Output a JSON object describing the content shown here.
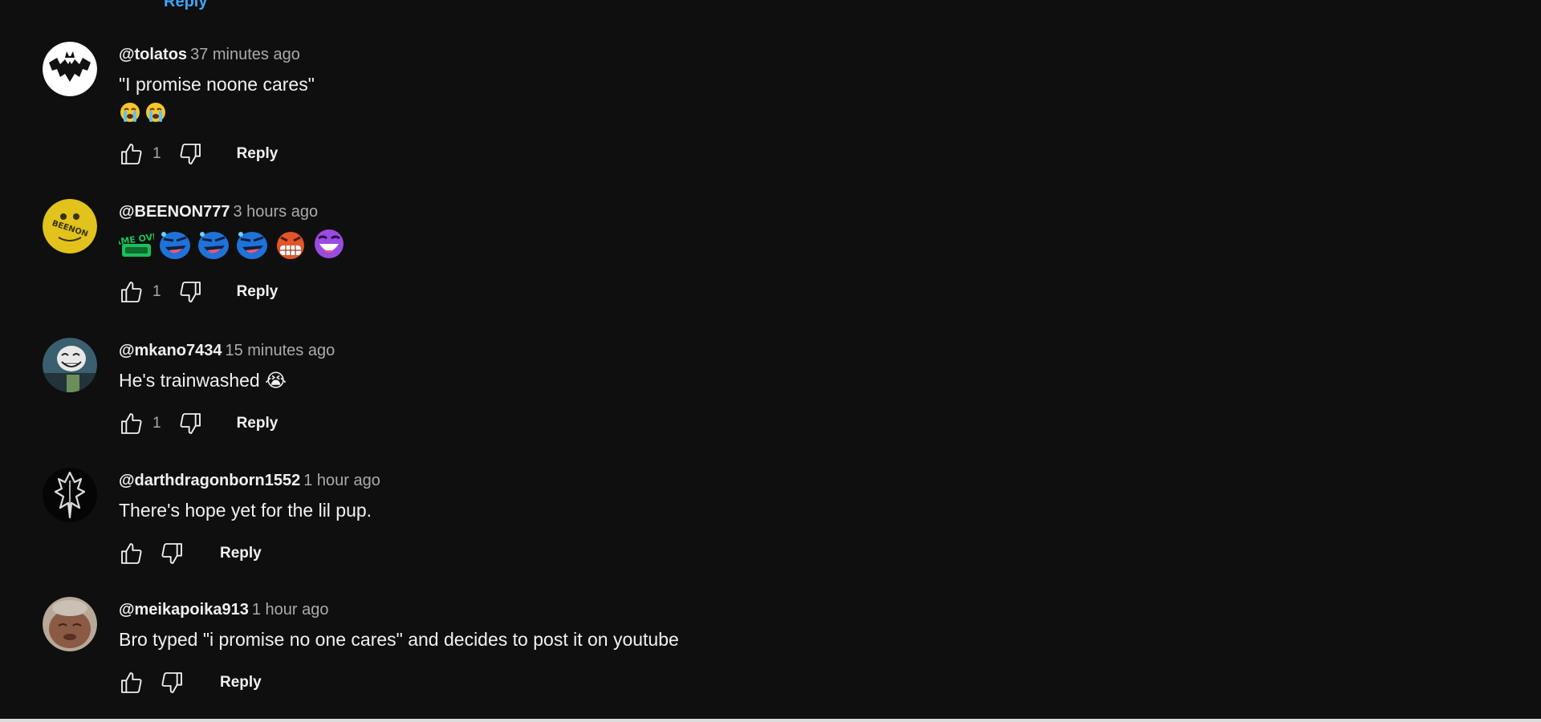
{
  "partial_reply": "Reply",
  "reply_label": "Reply",
  "comments": [
    {
      "author": "@tolatos",
      "time": "37 minutes ago",
      "text": "\"I promise noone cares\"",
      "emoji_line": [
        "loudly-crying-face",
        "loudly-crying-face"
      ],
      "likes": "1",
      "avatar": "bat-avatar"
    },
    {
      "author": "@BEENON777",
      "time": "3 hours ago",
      "text": "",
      "emoji_line": [
        "game-over-emote",
        "blue-laughing-emote",
        "blue-laughing-emote",
        "blue-laughing-emote",
        "red-gritted-teeth-emote",
        "purple-laughing-emote"
      ],
      "emote_text": "GAME OVER",
      "likes": "1",
      "avatar": "yellow-face-avatar",
      "avatar_text": "BEENON"
    },
    {
      "author": "@mkano7434",
      "time": "15 minutes ago",
      "text": "He's trainwashed 😭",
      "likes": "1",
      "avatar": "trollface-avatar"
    },
    {
      "author": "@darthdragonborn1552",
      "time": "1 hour ago",
      "text": "There's hope yet for the lil pup.",
      "likes": "",
      "avatar": "skyrim-emblem-avatar"
    },
    {
      "author": "@meikapoika913",
      "time": "1 hour ago",
      "text": "Bro typed \"i promise no one cares\" and decides to post it on youtube",
      "likes": "",
      "avatar": "face-photo-avatar"
    }
  ],
  "colors": {
    "background": "#0f0f0f",
    "text_primary": "#f1f1f1",
    "text_secondary": "#aaaaaa",
    "link_blue": "#3ea6ff"
  }
}
